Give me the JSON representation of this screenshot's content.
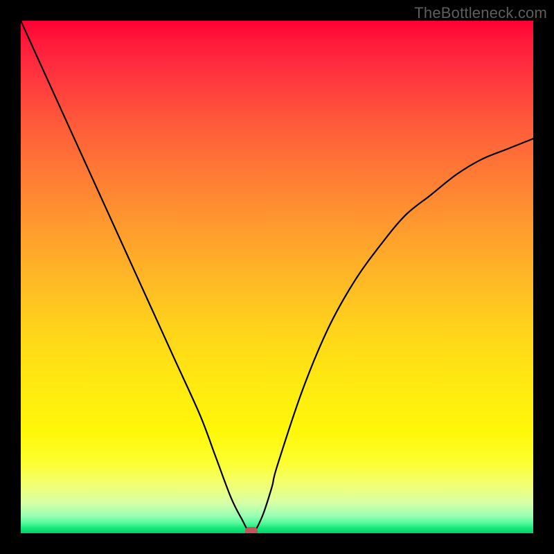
{
  "watermark": "TheBottleneck.com",
  "colors": {
    "frame": "#000000",
    "curve": "#000000",
    "marker": "#bd5a59"
  },
  "chart_data": {
    "type": "line",
    "title": "",
    "xlabel": "",
    "ylabel": "",
    "xlim": [
      0,
      100
    ],
    "ylim": [
      0,
      100
    ],
    "x": [
      0,
      5,
      10,
      15,
      20,
      25,
      30,
      35,
      38,
      41,
      43,
      45,
      47,
      49,
      50,
      55,
      60,
      65,
      70,
      75,
      80,
      85,
      90,
      95,
      100
    ],
    "y": [
      100,
      89,
      78,
      67,
      56,
      45,
      34,
      23,
      15,
      7,
      3,
      0,
      3,
      9,
      13,
      28,
      40,
      49,
      56,
      62,
      66,
      70,
      73,
      75,
      77
    ],
    "marker": {
      "x": 45,
      "y": 0
    },
    "note": "y-axis is drawn top-down (y=100 at top, 0 at bottom); no axis ticks are visible in the image"
  }
}
